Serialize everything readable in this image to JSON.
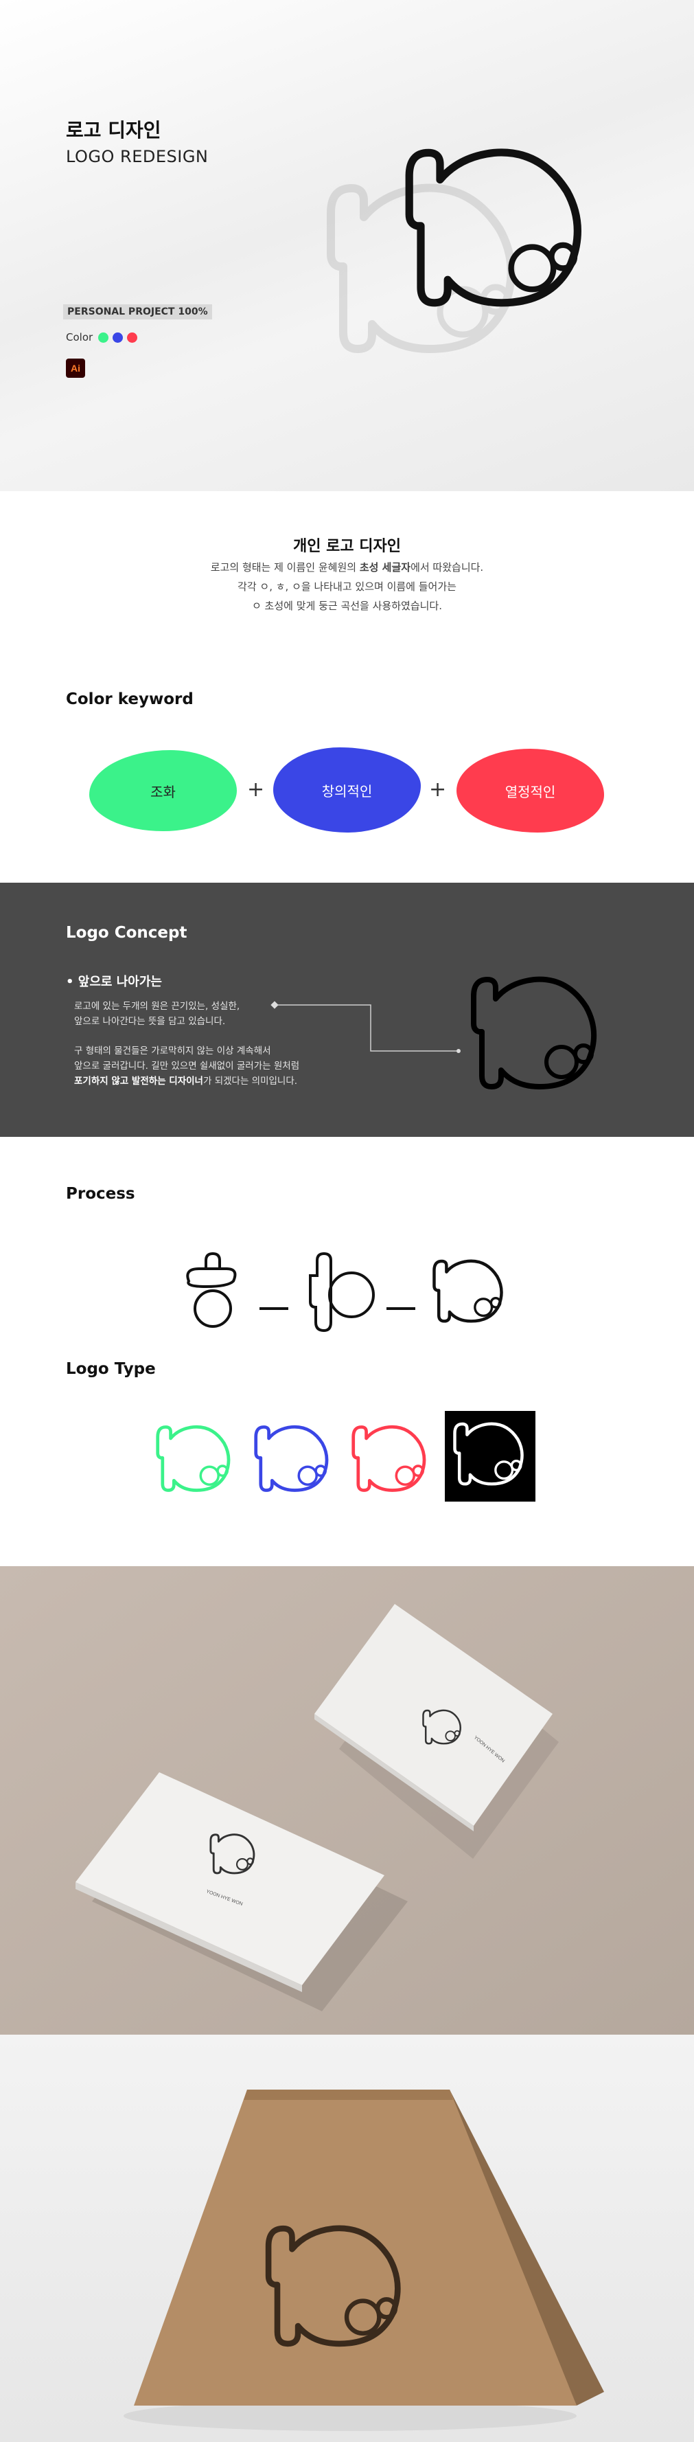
{
  "hero": {
    "title_ko": "로고 디자인",
    "title_en": "LOGO REDESIGN",
    "badge": "PERSONAL PROJECT 100%",
    "color_label": "Color",
    "colors": [
      "#3bf28a",
      "#3a46e6",
      "#ff3c4e"
    ],
    "ai_label": "Ai"
  },
  "intro": {
    "heading": "개인 로고 디자인",
    "line1_a": "로고의 형태는 제 이름인 윤혜원의 ",
    "line1_b": "초성 세글자",
    "line1_c": "에서 따왔습니다.",
    "line2": "각각 ㅇ, ㅎ, ㅇ을 나타내고 있으며 이름에 들어가는",
    "line3": "ㅇ 초성에 맞게 둥근 곡선을 사용하였습니다."
  },
  "color_keyword": {
    "heading": "Color keyword",
    "items": [
      {
        "label": "조화",
        "color": "#3bf28a",
        "text_color": "#222222"
      },
      {
        "label": "창의적인",
        "color": "#3a46e6",
        "text_color": "#ffffff"
      },
      {
        "label": "열정적인",
        "color": "#ff3c4e",
        "text_color": "#ffffff"
      }
    ],
    "plus": "+"
  },
  "concept": {
    "heading": "Logo Concept",
    "sub": "앞으로 나아가는",
    "p1": "로고에 있는 두개의 원은 끈기있는, 성실한,",
    "p2": "앞으로 나아간다는 뜻을 담고 있습니다.",
    "p3": "구 형태의 물건들은 가로막히지 않는 이상 계속해서",
    "p4": "앞으로 굴러갑니다. 길만 있으면 쉴새없이 굴러가는 원처럼",
    "p5_a": "포기하지 않고 발전하는 디자이너",
    "p5_b": "가 되겠다는 의미입니다."
  },
  "process": {
    "heading": "Process"
  },
  "logo_type": {
    "heading": "Logo Type",
    "variants": [
      {
        "name": "green",
        "stroke": "#3bf28a",
        "bg": "#ffffff"
      },
      {
        "name": "blue",
        "stroke": "#3a46e6",
        "bg": "#ffffff"
      },
      {
        "name": "red",
        "stroke": "#ff3c4e",
        "bg": "#ffffff"
      },
      {
        "name": "black",
        "stroke": "#ffffff",
        "bg": "#000000"
      }
    ]
  },
  "mockups": {
    "card_text_1": "YOON HYE WON",
    "card_text_2": "YOON HYE WON"
  }
}
